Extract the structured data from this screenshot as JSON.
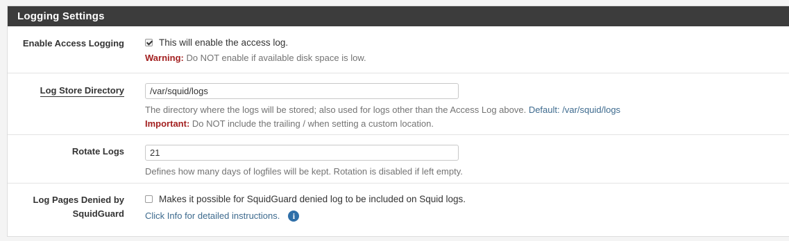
{
  "panel": {
    "title": "Logging Settings"
  },
  "rows": {
    "access_logging": {
      "label": "Enable Access Logging",
      "checked": true,
      "checkbox_text": "This will enable the access log.",
      "warning_prefix": "Warning:",
      "warning_text": " Do NOT enable if available disk space is low."
    },
    "log_dir": {
      "label": "Log Store Directory",
      "value": "/var/squid/logs",
      "help_text": "The directory where the logs will be stored; also used for logs other than the Access Log above. ",
      "default_text": "Default: /var/squid/logs",
      "important_prefix": "Important:",
      "important_text": " Do NOT include the trailing / when setting a custom location."
    },
    "rotate": {
      "label": "Rotate Logs",
      "value": "21",
      "help_text": "Defines how many days of logfiles will be kept. Rotation is disabled if left empty."
    },
    "denied": {
      "label_line1": "Log Pages Denied by",
      "label_line2": "SquidGuard",
      "checked": false,
      "checkbox_text": "Makes it possible for SquidGuard denied log to be included on Squid logs.",
      "info_text": "Click Info for detailed instructions.",
      "info_icon": "info-circle-icon"
    }
  },
  "colors": {
    "header_bg": "#3c3c3c",
    "warning": "#a32020",
    "link": "#3d6a8e",
    "info": "#2f6fa8"
  }
}
